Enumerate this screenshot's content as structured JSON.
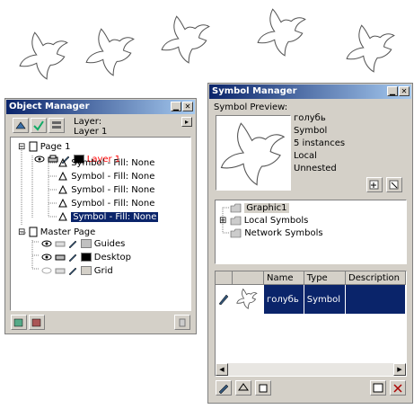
{
  "object_manager": {
    "title": "Object Manager",
    "layer_label": "Layer:",
    "layer_value": "Layer 1",
    "tree": {
      "page1": "Page 1",
      "layer1": "Layer 1",
      "symbols": [
        "Symbol - Fill: None",
        "Symbol - Fill: None",
        "Symbol - Fill: None",
        "Symbol - Fill: None",
        "Symbol - Fill: None"
      ],
      "master_page": "Master Page",
      "master_layers": [
        "Guides",
        "Desktop",
        "Grid"
      ]
    },
    "colors": {
      "layer1": "#ff0000",
      "selection": "#0a246a"
    }
  },
  "symbol_manager": {
    "title": "Symbol Manager",
    "preview_label": "Symbol Preview:",
    "info": [
      "голубь",
      "Symbol",
      "5 instances",
      "Local",
      "Unnested"
    ],
    "tree": [
      "Graphic1",
      "Local Symbols",
      "Network Symbols"
    ],
    "columns": [
      "Name",
      "Type",
      "Description"
    ],
    "rows": [
      {
        "name": "голубь",
        "type": "Symbol",
        "description": ""
      }
    ]
  }
}
